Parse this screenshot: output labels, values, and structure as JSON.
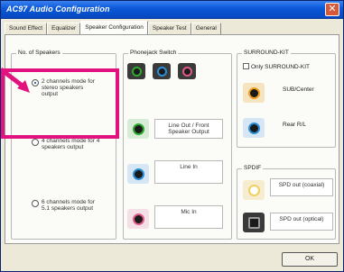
{
  "window": {
    "title": "AC97 Audio Configuration",
    "close_glyph": "✕"
  },
  "tabs": [
    {
      "label": "Sound Effect"
    },
    {
      "label": "Equalizer"
    },
    {
      "label": "Speaker Configuration",
      "active": true
    },
    {
      "label": "Speaker Test"
    },
    {
      "label": "General"
    }
  ],
  "speakers": {
    "group_label": "No. of Speakers",
    "options": [
      {
        "label_line1": "2 channels mode for",
        "label_line2": "stereo speakers",
        "label_line3": "output",
        "checked": true
      },
      {
        "label_line1": "4 channels mode for 4",
        "label_line2": "speakers output",
        "checked": false
      },
      {
        "label_line1": "6 channels mode for",
        "label_line2": "5.1 speakers output",
        "checked": false
      }
    ]
  },
  "phonejack": {
    "group_label": "Phonejack Switch",
    "jacks": [
      {
        "label_line1": "Line Out / Front",
        "label_line2": "Speaker Output",
        "color": "#2eaa2e"
      },
      {
        "label_line1": "Line In",
        "color": "#2b8fd6"
      },
      {
        "label_line1": "Mic In",
        "color": "#e05a8a"
      }
    ],
    "top_jacks": [
      {
        "color": "#2eaa2e"
      },
      {
        "color": "#2b8fd6"
      },
      {
        "color": "#e05a8a"
      }
    ]
  },
  "surround": {
    "group_label": "SURROUND-KIT",
    "checkbox_label": "Only SURROUND-KIT",
    "jacks": [
      {
        "label": "SUB/Center",
        "color": "#f0a020"
      },
      {
        "label": "Rear R/L",
        "color": "#2b8fd6"
      }
    ]
  },
  "spdif": {
    "group_label": "SPDIF",
    "items": [
      {
        "label": "SPD out (coaxial)"
      },
      {
        "label": "SPD out (optical)"
      }
    ]
  },
  "ok_button": {
    "label": "OK"
  },
  "colors": {
    "highlight": "#e2127e",
    "titlebar": "#0a58d8"
  }
}
